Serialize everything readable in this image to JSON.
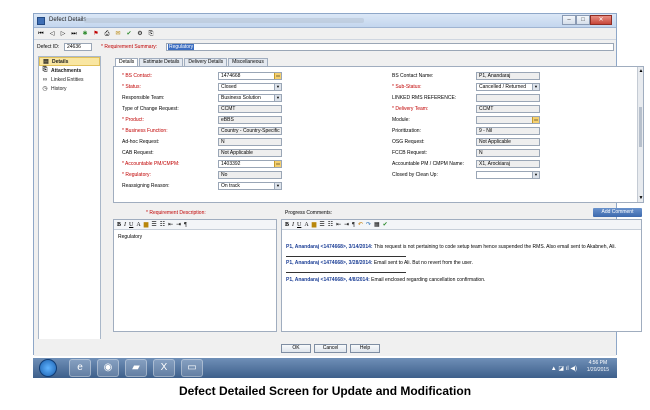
{
  "window": {
    "title": "Defect Details"
  },
  "id_row": {
    "id_label": "Defect ID:",
    "id_value": "24636",
    "summary_label": "* Requirement Summary:",
    "summary_value": "Regulatory"
  },
  "sidebar": {
    "items": [
      {
        "label": "Details"
      },
      {
        "label": "Attachments"
      },
      {
        "label": "Linked Entities"
      },
      {
        "label": "History"
      }
    ]
  },
  "tabs": [
    "Details",
    "Estimate Details",
    "Delivery Details",
    "Miscellaneous"
  ],
  "fields_left": [
    {
      "label": "* BS Contact:",
      "value": "1474668"
    },
    {
      "label": "* Status:",
      "value": "Closed"
    },
    {
      "label": "Responsible Team:",
      "value": "Business Solution"
    },
    {
      "label": "Type of Change Request:",
      "value": "CCMT"
    },
    {
      "label": "* Product:",
      "value": "eBBS"
    },
    {
      "label": "* Business Function:",
      "value": "Country - Country-Specific"
    },
    {
      "label": "Ad-hoc Request:",
      "value": "N"
    },
    {
      "label": "CAB Request:",
      "value": "Not Applicable"
    },
    {
      "label": "* Accountable PM/CMPM:",
      "value": "1403392"
    },
    {
      "label": "* Regulatory:",
      "value": "No"
    },
    {
      "label": "Reassigning Reason:",
      "value": "On track"
    }
  ],
  "fields_right": [
    {
      "label": "BS Contact Name:",
      "value": "P1, Anandaraj"
    },
    {
      "label": "* Sub-Status:",
      "value": "Cancelled / Returned"
    },
    {
      "label": "LINKED RMS REFERENCE:",
      "value": ""
    },
    {
      "label": "* Delivery Team:",
      "value": "CCMT"
    },
    {
      "label": "Module:",
      "value": ""
    },
    {
      "label": "Prioritization:",
      "value": "9 - Nil"
    },
    {
      "label": "OSG Request:",
      "value": "Not Applicable"
    },
    {
      "label": "FCCB Request:",
      "value": "N"
    },
    {
      "label": "Accountable PM / CMPM Name:",
      "value": "X1, Arockiaraj"
    },
    {
      "label": "Closed by Clean Up:",
      "value": ""
    }
  ],
  "description": {
    "label": "* Requirement Description:",
    "text": "Regulatory"
  },
  "comments": {
    "label": "Progress Comments:",
    "add_button": "Add Comment",
    "entries": [
      {
        "author": "P1, Anandaraj <1474668>, 3/14/2014:",
        "text": " This request is not pertaining to code setup team hence suspended the RMS. Also email sent to Akabneh, Ali."
      },
      {
        "author": "P1, Anandaraj <1474668>, 3/28/2014:",
        "text": " Email sent to Ali. But no revert from the user."
      },
      {
        "author": "P1, Anandaraj <1474668>, 4/8/2014:",
        "text": " Email enclosed regarding cancellation confirmation."
      }
    ]
  },
  "buttons": {
    "ok": "OK",
    "cancel": "Cancel",
    "help": "Help"
  },
  "taskbar": {
    "time": "4:56 PM",
    "date": "1/20/2015"
  },
  "caption": "Defect Detailed Screen for Update and Modification"
}
